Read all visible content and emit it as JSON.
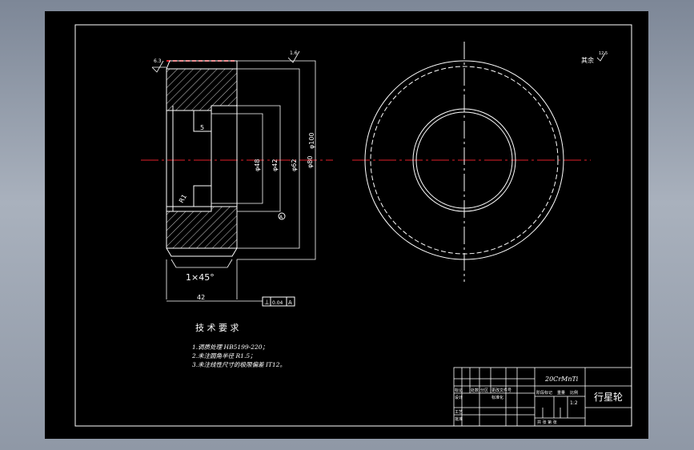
{
  "surface_finish": {
    "top_left": "6.3",
    "top_right": "1.6",
    "remaining": "其余",
    "remaining_value": "12.5"
  },
  "dimensions": {
    "groove_width": "5",
    "chamfer_spec": "1×45°",
    "width": "42",
    "fillet": "R1",
    "dia_groove": "φ48",
    "dia_inner": "φ42",
    "dia_bore_lower": "φ62",
    "dia_bore": "φ80",
    "dia_outer": "φ100",
    "tolerance_symbol": "⊥",
    "tolerance_value": "0.04",
    "tolerance_datum": "A",
    "datum_label": "A"
  },
  "requirements": {
    "title": "技 术 要 求",
    "items": [
      "1.调质处理 HB5199-220；",
      "2.未注圆角半径 R1.5；",
      "3.未注线性尺寸的极限偏差    IT12。"
    ]
  },
  "title_block": {
    "material": "20CrMnTi",
    "part_name": "行星轮",
    "row_labels": [
      "标记",
      "处数",
      "分区",
      "更改文件号"
    ],
    "design": "设计",
    "standardize": "标准化",
    "approve": "批准",
    "process": "工艺",
    "stage_label": "阶段标记",
    "weight_label": "重量",
    "scale_label": "比例",
    "scale_value": "1:2",
    "sheet_label": "共 张 第 张"
  }
}
